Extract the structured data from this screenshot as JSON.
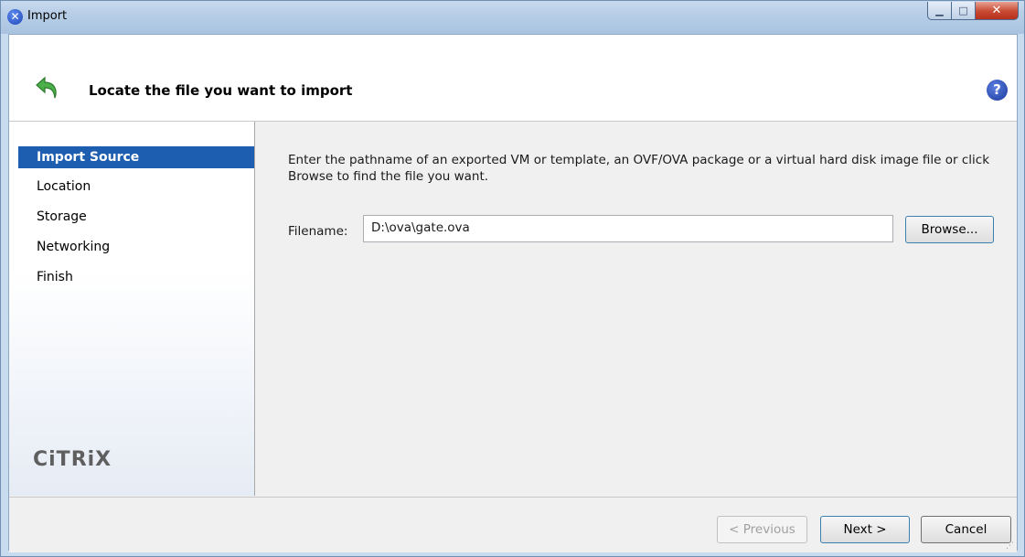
{
  "window": {
    "title": "Import"
  },
  "header": {
    "title": "Locate the file you want to import",
    "help": "?"
  },
  "sidebar": {
    "items": [
      {
        "label": "Import Source",
        "active": true
      },
      {
        "label": "Location",
        "active": false
      },
      {
        "label": "Storage",
        "active": false
      },
      {
        "label": "Networking",
        "active": false
      },
      {
        "label": "Finish",
        "active": false
      }
    ],
    "logo_text": "CiTRiX"
  },
  "main": {
    "description": "Enter the pathname of an exported VM or template, an OVF/OVA package or a virtual hard disk image file or click Browse to find the file you want.",
    "filename_label": "Filename:",
    "filename_value": "D:\\ova\\gate.ova",
    "browse_label": "Browse..."
  },
  "footer": {
    "previous_label": "< Previous",
    "next_label": "Next >",
    "cancel_label": "Cancel"
  },
  "colors": {
    "accent": "#1e5eb0",
    "title_bar": "#b6cde6",
    "close_button": "#c74a33"
  },
  "icons": {
    "app": "xenserver-icon",
    "header": "back-arrow-icon",
    "help": "help-icon"
  }
}
